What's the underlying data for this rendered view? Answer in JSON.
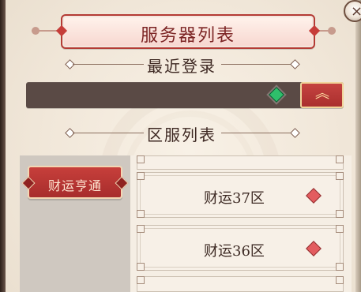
{
  "title": "服务器列表",
  "close_icon": "close-icon",
  "sections": {
    "recent": "最近登录",
    "list": "区服列表"
  },
  "recent_bar": {
    "status_color": "#2fbf6b",
    "expand_icon": "double-chevron-up-icon"
  },
  "tabs": [
    {
      "label": "财运亨通"
    }
  ],
  "servers": [
    {
      "name": "",
      "status_color": "#e35c5f"
    },
    {
      "name": "财运37区",
      "status_color": "#e35c5f"
    },
    {
      "name": "财运36区",
      "status_color": "#e35c5f"
    },
    {
      "name": "",
      "status_color": "#e35c5f"
    }
  ],
  "colors": {
    "accent_red": "#b43a34",
    "panel_bg": "#f1e7d9",
    "dark_bar": "#5a4a45"
  }
}
